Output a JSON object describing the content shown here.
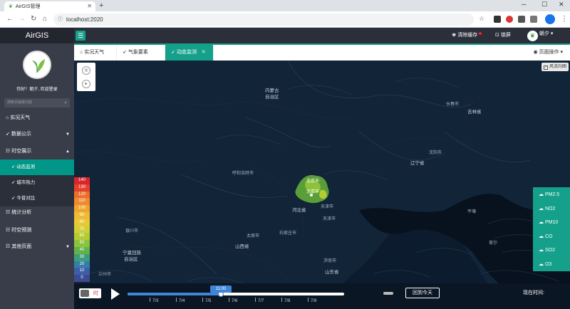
{
  "browser": {
    "tab_title": "AirGIS管理",
    "url": "localhost:2020",
    "new_tab": "+",
    "win_min": "─",
    "win_max": "☐",
    "win_close": "✕"
  },
  "header": {
    "brand": "AirGIS",
    "clear_cache": "清除缓存",
    "lock_screen": "锁屏",
    "username": "朝夕"
  },
  "sidebar": {
    "welcome": "你好！朝夕, 欢迎登录",
    "search_placeholder": "搜索页面或功能",
    "items": [
      {
        "icon": "⌂",
        "label": "实况天气"
      },
      {
        "icon": "➶",
        "label": "数据公示"
      },
      {
        "icon": "☷",
        "label": "时空展示"
      },
      {
        "icon": "➶",
        "label": "动态监测"
      },
      {
        "icon": "➶",
        "label": "城市热力"
      },
      {
        "icon": "➶",
        "label": "今昔对比"
      },
      {
        "icon": "☷",
        "label": "统计分析"
      },
      {
        "icon": "☷",
        "label": "时空预测"
      },
      {
        "icon": "☷",
        "label": "其他页面"
      }
    ]
  },
  "tabs": [
    {
      "icon": "⌂",
      "label": "实况天气"
    },
    {
      "icon": "➶",
      "label": "气象要素"
    },
    {
      "icon": "➶",
      "label": "动态监测"
    }
  ],
  "page_ops": "页面操作",
  "map": {
    "wind_toggle": "风流向图",
    "pollutants": [
      "PM2.5",
      "NO2",
      "PM10",
      "CO",
      "SO2",
      "O3"
    ],
    "legend": [
      {
        "value": "140",
        "color": "#d9262d"
      },
      {
        "value": "130",
        "color": "#e6402c"
      },
      {
        "value": "120",
        "color": "#ec6d2c"
      },
      {
        "value": "110",
        "color": "#ef8a2e"
      },
      {
        "value": "100",
        "color": "#f0a431"
      },
      {
        "value": "90",
        "color": "#f0ba33"
      },
      {
        "value": "80",
        "color": "#e8c935"
      },
      {
        "value": "70",
        "color": "#d1cf36"
      },
      {
        "value": "60",
        "color": "#b3cc36"
      },
      {
        "value": "50",
        "color": "#8cc33a"
      },
      {
        "value": "40",
        "color": "#5fb349"
      },
      {
        "value": "30",
        "color": "#3d9c7d"
      },
      {
        "value": "20",
        "color": "#347fa8"
      },
      {
        "value": "10",
        "color": "#3d5ea8"
      },
      {
        "value": "0",
        "color": "#3d4a8f"
      }
    ],
    "places": [
      {
        "name": "内蒙古",
        "cls": "prov"
      },
      {
        "name": "自治区",
        "cls": "prov"
      },
      {
        "name": "长春市",
        "cls": "city"
      },
      {
        "name": "吉林省",
        "cls": "prov"
      },
      {
        "name": "沈阳市",
        "cls": "city"
      },
      {
        "name": "辽宁省",
        "cls": "prov"
      },
      {
        "name": "呼和浩特市",
        "cls": "city"
      },
      {
        "name": "北京市",
        "cls": "city"
      },
      {
        "name": "北京市",
        "cls": "city"
      },
      {
        "name": "河北省",
        "cls": "prov"
      },
      {
        "name": "天津市",
        "cls": "city"
      },
      {
        "name": "天津市",
        "cls": "city"
      },
      {
        "name": "平壤",
        "cls": "city"
      },
      {
        "name": "银川市",
        "cls": "city"
      },
      {
        "name": "太原市",
        "cls": "city"
      },
      {
        "name": "石家庄市",
        "cls": "city"
      },
      {
        "name": "首尔",
        "cls": "city"
      },
      {
        "name": "山西省",
        "cls": "prov"
      },
      {
        "name": "济南市",
        "cls": "city"
      },
      {
        "name": "宁夏回族",
        "cls": "prov"
      },
      {
        "name": "自治区",
        "cls": "prov"
      },
      {
        "name": "山东省",
        "cls": "prov"
      },
      {
        "name": "兰州市",
        "cls": "city"
      }
    ]
  },
  "timeline": {
    "hour_toggle": "时",
    "current_time": "11:00",
    "progress": 0.43,
    "dates": [
      "7/3",
      "7/4",
      "7/5",
      "7/6",
      "7/7",
      "7/8",
      "7/9"
    ],
    "back_today": "回到今天",
    "now_label": "现在时间:"
  }
}
